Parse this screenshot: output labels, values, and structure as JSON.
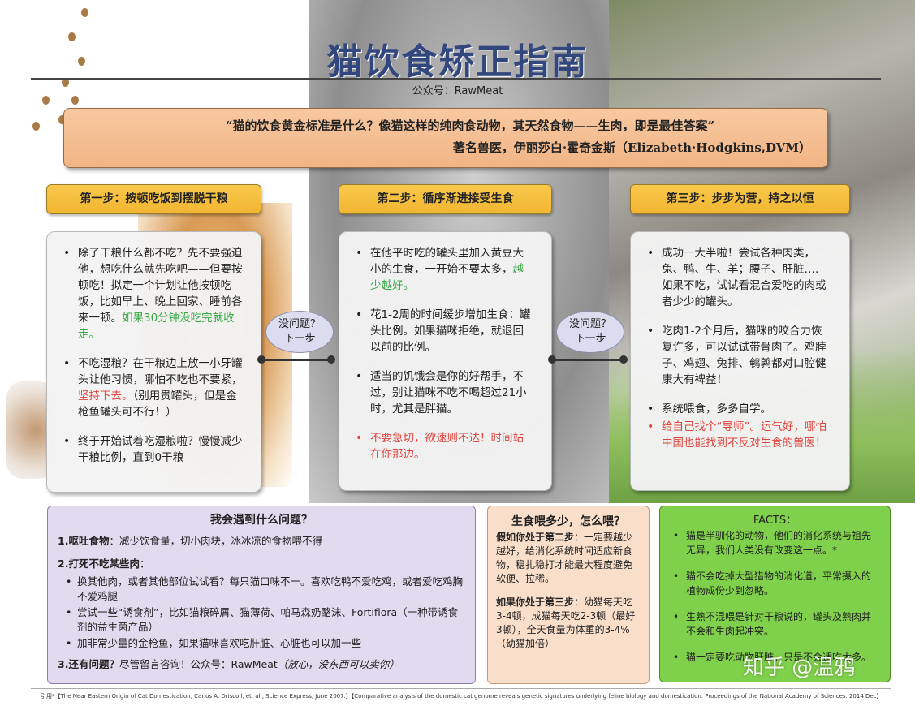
{
  "header": {
    "title": "猫饮食矫正指南",
    "subtitle": "公众号：RawMeat"
  },
  "quote": {
    "text": "“猫的饮食黄金标准是什么？像猫这样的纯肉食动物，其天然食物——生肉，即是最佳答案”",
    "author": "著名兽医，伊丽莎白·霍奇金斯（Elizabeth·Hodgkins,DVM）"
  },
  "steps": [
    {
      "title": "第一步：按顿吃饭到摆脱干粮",
      "items": [
        {
          "text": "除了干粮什么都不吃？先不要强迫他，想吃什么就先吃吧——但要按顿吃！拟定一个计划让他按顿吃饭，比如早上、晚上回家、睡前各来一顿。",
          "highlight": "如果30分钟没吃完就收走。",
          "tail": ""
        },
        {
          "text": "不吃湿粮？在干粮边上放一小牙罐头让他习惯，哪怕不吃也不要紧，",
          "highlight": "坚持下去。",
          "tail": "（别用贵罐头，但是金枪鱼罐头可不行！）"
        },
        {
          "text": "终于开始试着吃湿粮啦？慢慢减少干粮比例，直到0干粮",
          "highlight": "",
          "tail": ""
        }
      ]
    },
    {
      "title": "第二步：循序渐进接受生食",
      "items": [
        {
          "text": "在他平时吃的罐头里加入黄豆大小的生食，一开始不要太多，",
          "highlight": "越少越好。",
          "tail": ""
        },
        {
          "text": "花1-2周的时间缓步增加生食：罐头比例。如果猫咪拒绝，就退回以前的比例。",
          "highlight": "",
          "tail": ""
        },
        {
          "text": "适当的饥饿会是你的好帮手，不过，别让猫咪不吃不喝超过21小时，尤其是胖猫。",
          "highlight": "",
          "tail": ""
        },
        {
          "text": "不要急切，欲速则不达！时间站在你那边。",
          "highlight": "",
          "tail": ""
        }
      ]
    },
    {
      "title": "第三步：步步为营，持之以恒",
      "items": [
        {
          "text": "成功一大半啦！尝试各种肉类，兔、鸭、牛、羊；腰子、肝脏…. 如果不吃，试试看混合爱吃的肉或者少少的罐头。",
          "highlight": "",
          "tail": ""
        },
        {
          "text": "吃肉1-2个月后，猫咪的咬合力恢复许多，可以试试带骨肉了。鸡脖子、鸡翅、兔排、鹌鹑都对口腔健康大有裨益！",
          "highlight": "",
          "tail": ""
        },
        {
          "text": "系统喂食，多多自学。",
          "highlight": "",
          "tail": ""
        },
        {
          "text": "给自己找个“导师”。运气好，哪怕中国也能找到不反对生食的兽医！",
          "highlight": "",
          "tail": ""
        }
      ]
    }
  ],
  "connectors": [
    {
      "label_line1": "没问题？",
      "label_line2": "下一步"
    },
    {
      "label_line1": "没问题？",
      "label_line2": "下一步"
    }
  ],
  "problems": {
    "title": "我会遇到什么问题？",
    "s1_label": "1.呕吐食物",
    "s1_text": "：减少饮食量，切小肉块，冰冰凉的食物喂不得",
    "s2_label": "2.打死不吃某些肉",
    "s2_colon": "：",
    "s2_items": [
      "换其他肉，或者其他部位试试看？每只猫口味不一。喜欢吃鸭不爱吃鸡，或者爱吃鸡胸不爱鸡腿",
      "尝试一些“诱食剂”，比如猫粮碎屑、猫薄荷、帕马森奶酪沫、Fortiflora（一种带诱食剂的益生菌产品）",
      "加非常少量的金枪鱼，如果猫咪喜欢吃肝脏、心脏也可以加一些"
    ],
    "s3_label": "3.还有问题？",
    "s3_text": "尽管留言咨询！公众号：RawMeat",
    "s3_note": "（放心，没东西可以卖你）"
  },
  "feeding": {
    "title": "生食喂多少，怎么喂？",
    "p1_label": "假如你处于第二步",
    "p1_text": "：一定要越少越好，给消化系统时间适应新食物，稳扎稳打才能最大程度避免软便、拉稀。",
    "p2_label": "如果你处于第三步",
    "p2_text": "：幼猫每天吃3-4顿，成猫每天吃2-3顿（最好3顿），全天食量为体重的3-4%（幼猫加倍）"
  },
  "facts": {
    "title": "FACTS：",
    "items": [
      "猫是半驯化的动物，他们的消化系统与祖先无异，我们人类没有改变这一点。*",
      "猫不会吃掉大型猎物的消化道，平常摄入的植物成份少到忽略。",
      "生熟不混喂是针对干粮说的，罐头及熟肉并不会和生肉起冲突。",
      "猫一定要吃动物肝脏，只是不会适吃太多。"
    ]
  },
  "footnote": "引用*【The Near Eastern Origin of Cat Domestication, Carlos A. Driscoll, et. al., Science Express, June 2007.】【Comparative analysis of the domestic cat genome reveals genetic signatures underlying feline biology and domestication. Proceedings of the National Academy of Sciences. 2014 Dec】",
  "watermark": "知乎 @温鸦",
  "colors": {
    "title": "#33477f",
    "step_header": "#f2b531",
    "quote_bg": "#f2b585",
    "highlight_green": "#37a845",
    "highlight_red": "#e0443e",
    "problems_bg": "#e2dbef",
    "feeding_bg": "#f9dfca",
    "facts_bg": "#7fd04a"
  }
}
